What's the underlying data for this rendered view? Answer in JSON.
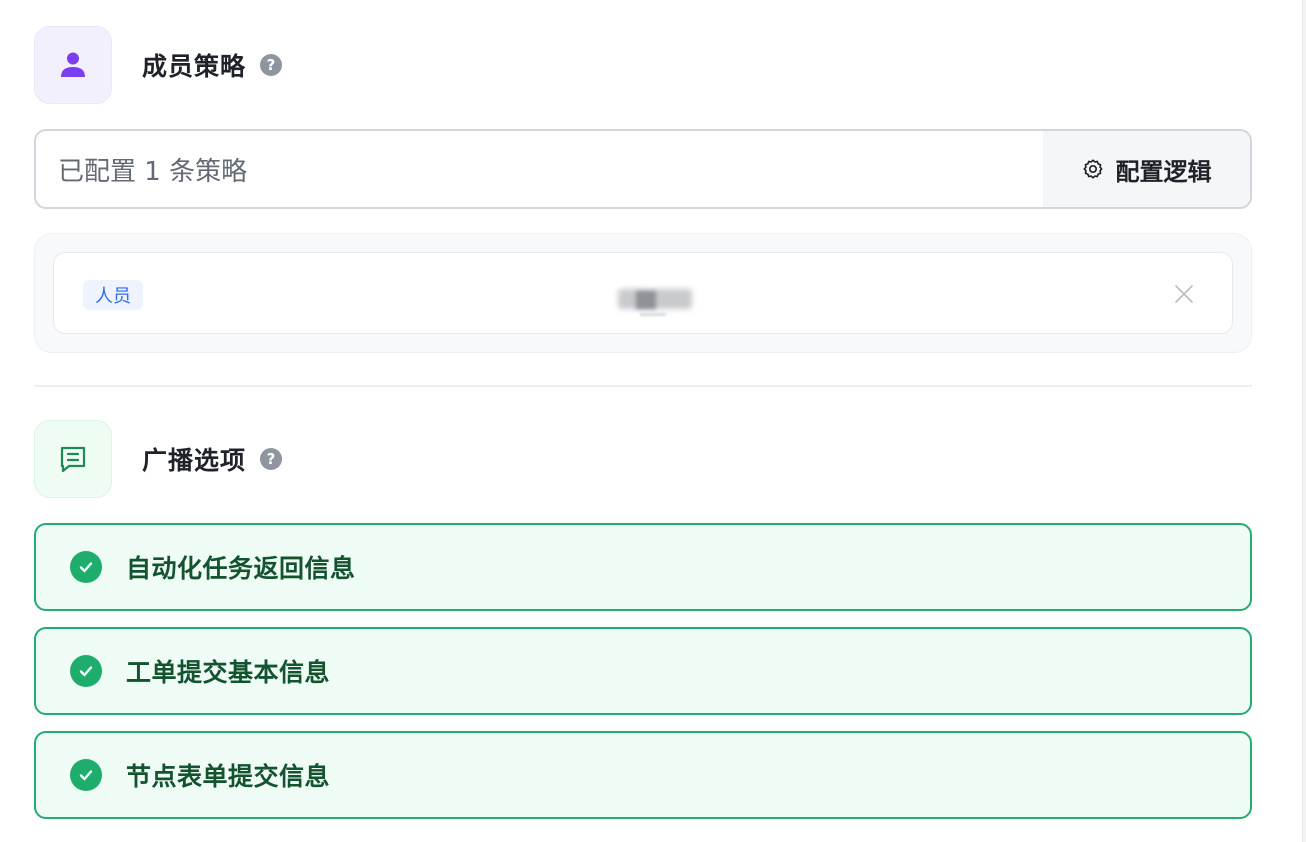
{
  "member_policy": {
    "title": "成员策略",
    "icon": "user-icon",
    "help": "?",
    "summary": "已配置 1 条策略",
    "config_button": "配置逻辑",
    "rules": [
      {
        "tag": "人员",
        "value_redacted": true
      }
    ]
  },
  "broadcast": {
    "title": "广播选项",
    "icon": "message-icon",
    "help": "?",
    "options": [
      {
        "label": "自动化任务返回信息",
        "checked": true
      },
      {
        "label": "工单提交基本信息",
        "checked": true
      },
      {
        "label": "节点表单提交信息",
        "checked": true
      }
    ]
  },
  "colors": {
    "accent_purple": "#7b3ff2",
    "tag_blue": "#2f6bf2",
    "success_green": "#1fad6d",
    "option_text": "#14532f"
  }
}
